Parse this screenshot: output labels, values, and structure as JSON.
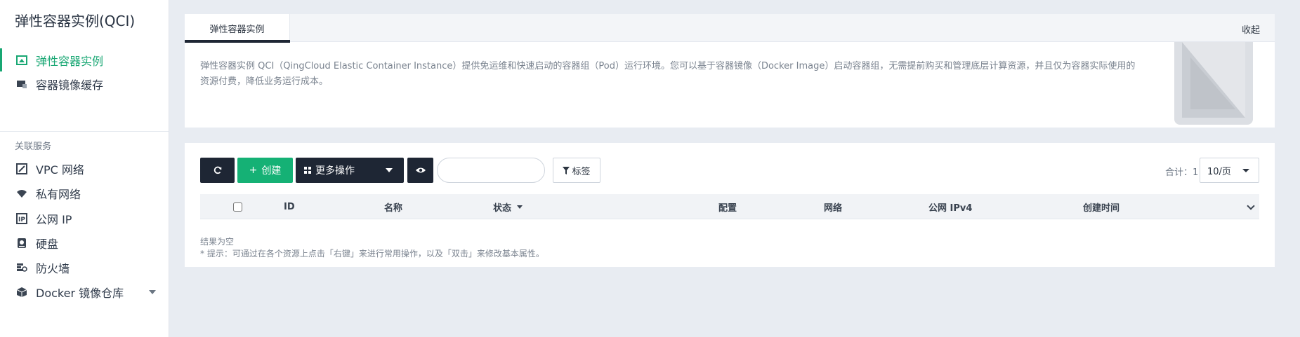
{
  "sidebar": {
    "title": "弹性容器实例(QCI)",
    "items": [
      {
        "label": "弹性容器实例"
      },
      {
        "label": "容器镜像缓存"
      }
    ],
    "section_label": "关联服务",
    "related": [
      {
        "label": "VPC 网络"
      },
      {
        "label": "私有网络"
      },
      {
        "label": "公网 IP"
      },
      {
        "label": "硬盘"
      },
      {
        "label": "防火墙"
      },
      {
        "label": "Docker 镜像仓库"
      }
    ]
  },
  "intro": {
    "tab_label": "弹性容器实例",
    "collapse_label": "收起",
    "description": "弹性容器实例 QCI（QingCloud Elastic Container Instance）提供免运维和快速启动的容器组（Pod）运行环境。您可以基于容器镜像（Docker Image）启动容器组，无需提前购买和管理底层计算资源，并且仅为容器实际使用的资源付费，降低业务运行成本。"
  },
  "toolbar": {
    "create_label": "创建",
    "more_label": "更多操作",
    "search_placeholder": "",
    "tag_label": "标签",
    "total_label": "合计：1",
    "page_size": "10/页"
  },
  "table": {
    "columns": [
      "ID",
      "名称",
      "状态",
      "配置",
      "网络",
      "公网 IPv4",
      "创建时间"
    ],
    "empty_text": "结果为空",
    "hint_text": "* 提示：可通过在各个资源上点击「右键」来进行常用操作，以及「双击」来修改基本属性。"
  },
  "colors": {
    "accent": "#15b175",
    "dark": "#1e2634",
    "page_bg": "#e8ecf2"
  }
}
